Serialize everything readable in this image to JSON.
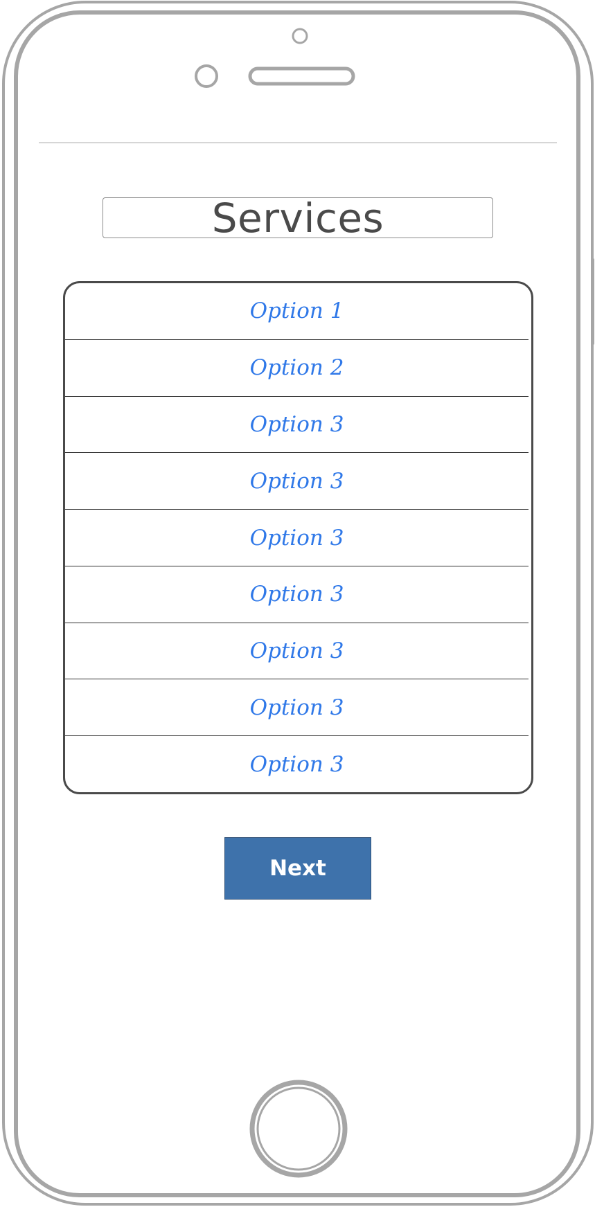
{
  "header": {
    "title": "Services"
  },
  "list": {
    "items": [
      {
        "label": "Option 1"
      },
      {
        "label": "Option 2"
      },
      {
        "label": "Option 3"
      },
      {
        "label": "Option 3"
      },
      {
        "label": "Option 3"
      },
      {
        "label": "Option 3"
      },
      {
        "label": "Option 3"
      },
      {
        "label": "Option 3"
      },
      {
        "label": "Option 3"
      }
    ]
  },
  "footer": {
    "next_label": "Next"
  },
  "colors": {
    "option_text": "#2f78e8",
    "button_fill": "#3e72ab",
    "phone_outline": "#a6a6a6",
    "title_text": "#4a4a4a"
  }
}
